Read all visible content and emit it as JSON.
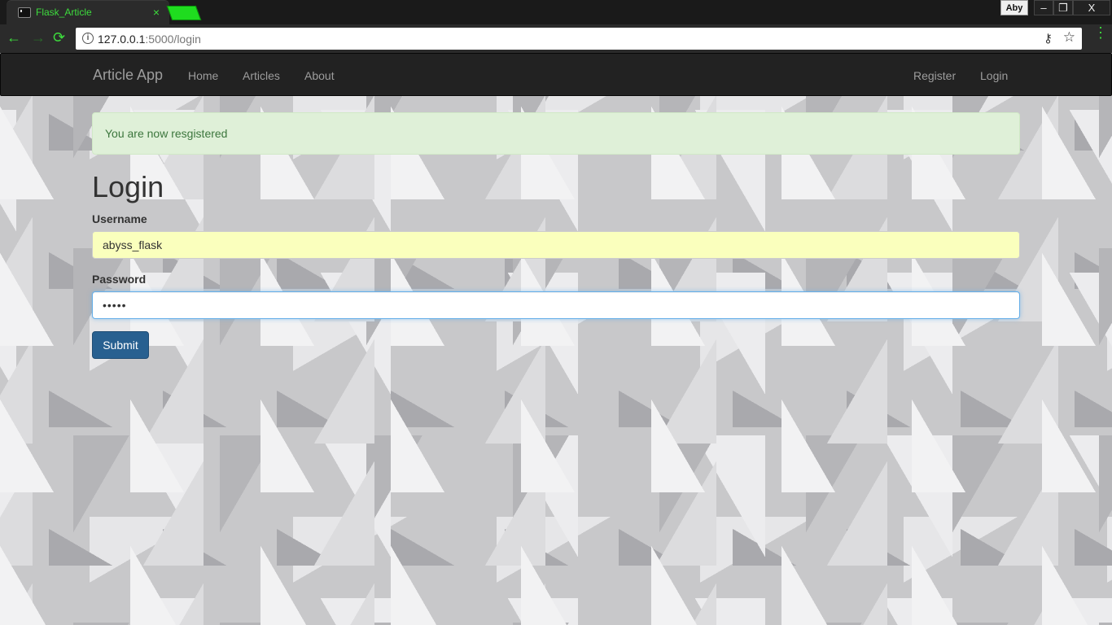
{
  "browser": {
    "tab_title": "Flask_Article",
    "tab_close": "×",
    "profile": "Aby",
    "window_min": "–",
    "window_max": "❐",
    "window_close": "X",
    "url_host": "127.0.0.1",
    "url_rest": ":5000/login",
    "info": "i",
    "key": "⚷",
    "star": "☆",
    "back": "←",
    "forward": "→",
    "reload": "⟳",
    "menu": "⋮"
  },
  "navbar": {
    "brand": "Article App",
    "links": [
      "Home",
      "Articles",
      "About"
    ],
    "right_links": [
      "Register",
      "Login"
    ]
  },
  "alert": {
    "message": "You are now resgistered"
  },
  "form": {
    "heading": "Login",
    "username_label": "Username",
    "username_value": "abyss_flask",
    "password_label": "Password",
    "password_value": "•••••",
    "submit_label": "Submit"
  },
  "colors": {
    "tab_accent": "#3ddc3d",
    "navbar_bg": "#222222",
    "alert_bg": "#dff0d8",
    "alert_text": "#3c763d",
    "primary_button": "#286090",
    "autofill_bg": "#faffbd"
  }
}
